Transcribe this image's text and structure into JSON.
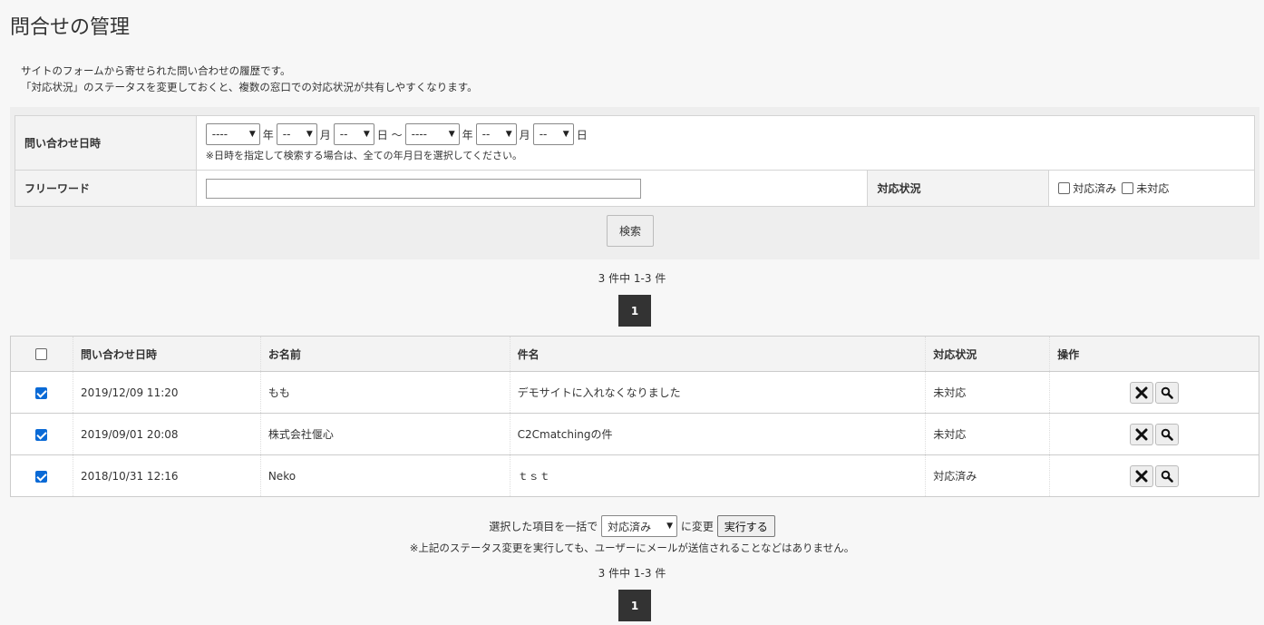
{
  "page": {
    "title": "問合せの管理",
    "desc_line1": "サイトのフォームから寄せられた問い合わせの履歴です。",
    "desc_line2": "「対応状況」のステータスを変更しておくと、複数の窓口での対応状況が共有しやすくなります。"
  },
  "search": {
    "date_label": "問い合わせ日時",
    "year_from": "----",
    "month_from": "--",
    "day_from": "--",
    "year_to": "----",
    "month_to": "--",
    "day_to": "--",
    "unit_year": "年",
    "unit_month": "月",
    "unit_day": "日",
    "range_sep": "～",
    "date_note": "※日時を指定して検索する場合は、全ての年月日を選択してください。",
    "word_label": "フリーワード",
    "word_value": "",
    "status_label": "対応状況",
    "status_done": "対応済み",
    "status_todo": "未対応",
    "button": "検索"
  },
  "pagination": {
    "summary": "3 件中 1-3 件",
    "current": "1"
  },
  "table": {
    "headers": {
      "datetime": "問い合わせ日時",
      "name": "お名前",
      "subject": "件名",
      "status": "対応状況",
      "ops": "操作"
    },
    "rows": [
      {
        "datetime": "2019/12/09 11:20",
        "name": "もも",
        "subject": "デモサイトに入れなくなりました",
        "status": "未対応",
        "checked": true
      },
      {
        "datetime": "2019/09/01 20:08",
        "name": "株式会社偃心",
        "subject": "C2Cmatchingの件",
        "status": "未対応",
        "checked": true
      },
      {
        "datetime": "2018/10/31 12:16",
        "name": "Neko",
        "subject": "ｔｓｔ",
        "status": "対応済み",
        "checked": true
      }
    ]
  },
  "bulk": {
    "prefix": "選択した項目を一括で",
    "selected": "対応済み",
    "suffix": "に変更",
    "button": "実行する",
    "note": "※上記のステータス変更を実行しても、ユーザーにメールが送信されることなどはありません。"
  },
  "colors": {
    "page_bg": "#f7f7f7",
    "pager_bg": "#333333",
    "checkbox_checked": "#0a6ad6"
  },
  "icons": {
    "delete": "close-icon",
    "detail": "search-icon"
  }
}
